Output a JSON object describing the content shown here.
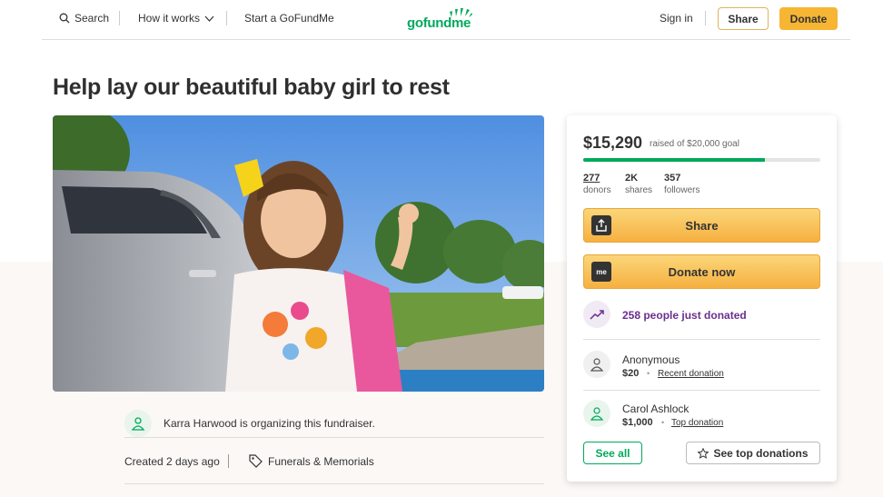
{
  "header": {
    "search_label": "Search",
    "how_it_works_label": "How it works",
    "start_label": "Start a GoFundMe",
    "logo_text": "gofundme",
    "sign_in_label": "Sign in",
    "share_label": "Share",
    "donate_label": "Donate"
  },
  "campaign": {
    "title": "Help lay our beautiful baby girl to rest",
    "organizer_text": "Karra Harwood is organizing this fundraiser.",
    "created_text": "Created 2 days ago",
    "category": "Funerals & Memorials"
  },
  "donation_card": {
    "raised": "$15,290",
    "goal_text": "raised of $20,000 goal",
    "progress_fraction": 0.7645,
    "stats": [
      {
        "value": "277",
        "label": "donors"
      },
      {
        "value": "2K",
        "label": "shares"
      },
      {
        "value": "357",
        "label": "followers"
      }
    ],
    "share_button_label": "Share",
    "donate_button_label": "Donate now",
    "donate_icon_text": "me",
    "trending_text": "258 people just donated",
    "donations": [
      {
        "name": "Anonymous",
        "amount": "$20",
        "tag": "Recent donation"
      },
      {
        "name": "Carol Ashlock",
        "amount": "$1,000",
        "tag": "Top donation"
      }
    ],
    "see_all_label": "See all",
    "see_top_label": "See top donations"
  },
  "colors": {
    "brand_green": "#02a95c",
    "donate_yellow": "#f6b533",
    "trending_purple": "#6b2f8f"
  }
}
